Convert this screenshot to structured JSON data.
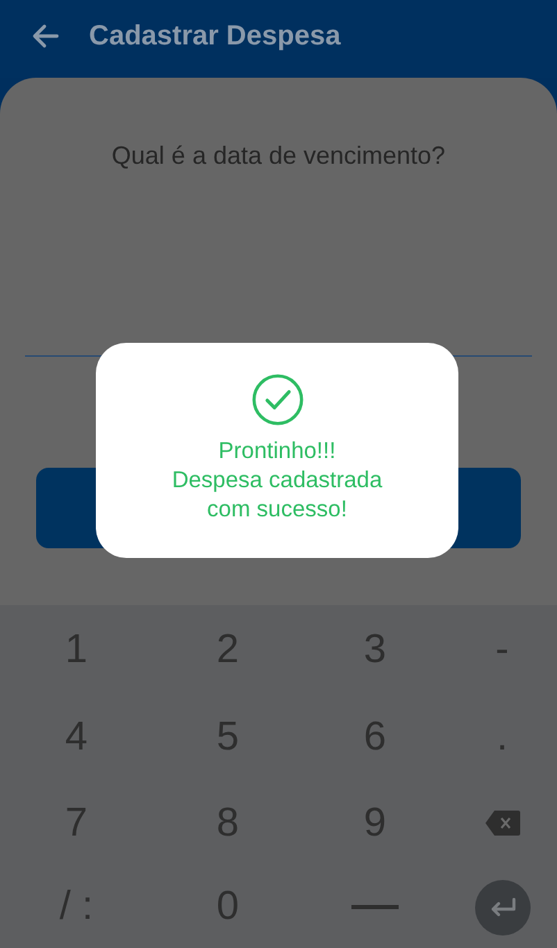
{
  "app_bar": {
    "title": "Cadastrar Despesa"
  },
  "form": {
    "question": "Qual é a data de vencimento?"
  },
  "dialog": {
    "lines": [
      "Prontinho!!!",
      "Despesa cadastrada",
      "com sucesso!"
    ]
  },
  "keyboard": {
    "keys": [
      {
        "kind": "text",
        "label": "1"
      },
      {
        "kind": "text",
        "label": "2"
      },
      {
        "kind": "text",
        "label": "3"
      },
      {
        "kind": "text",
        "label": "-"
      },
      {
        "kind": "text",
        "label": "4"
      },
      {
        "kind": "text",
        "label": "5"
      },
      {
        "kind": "text",
        "label": "6"
      },
      {
        "kind": "text",
        "label": "."
      },
      {
        "kind": "text",
        "label": "7"
      },
      {
        "kind": "text",
        "label": "8"
      },
      {
        "kind": "text",
        "label": "9"
      },
      {
        "kind": "backspace"
      },
      {
        "kind": "text",
        "label": "/ :"
      },
      {
        "kind": "text",
        "label": "0"
      },
      {
        "kind": "space"
      },
      {
        "kind": "enter"
      }
    ]
  }
}
